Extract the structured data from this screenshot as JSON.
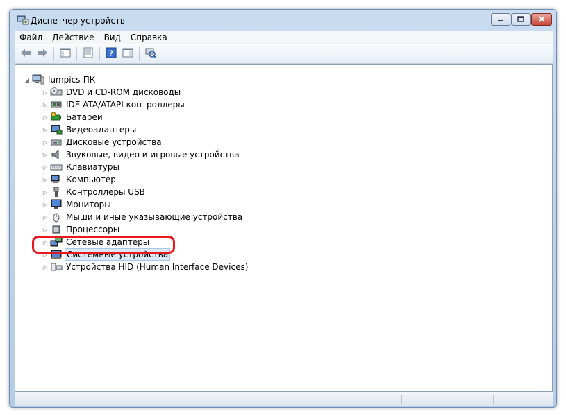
{
  "window": {
    "title": "Диспетчер устройств"
  },
  "menu": [
    "Файл",
    "Действие",
    "Вид",
    "Справка"
  ],
  "toolbar": {
    "buttons": [
      "back-arrow-icon",
      "forward-arrow-icon",
      "show-hide-tree-icon",
      "properties-icon",
      "help-icon",
      "action-pane-icon",
      "scan-hardware-icon"
    ]
  },
  "tree": {
    "root": "lumpics-ПК",
    "items": [
      {
        "label": "DVD и CD-ROM дисководы",
        "icon": "dvd-drive-icon"
      },
      {
        "label": "IDE ATA/ATAPI контроллеры",
        "icon": "ide-controller-icon"
      },
      {
        "label": "Батареи",
        "icon": "battery-icon"
      },
      {
        "label": "Видеоадаптеры",
        "icon": "display-adapter-icon"
      },
      {
        "label": "Дисковые устройства",
        "icon": "disk-drive-icon"
      },
      {
        "label": "Звуковые, видео и игровые устройства",
        "icon": "sound-icon"
      },
      {
        "label": "Клавиатуры",
        "icon": "keyboard-icon"
      },
      {
        "label": "Компьютер",
        "icon": "computer-icon"
      },
      {
        "label": "Контроллеры USB",
        "icon": "usb-icon"
      },
      {
        "label": "Мониторы",
        "icon": "monitor-icon"
      },
      {
        "label": "Мыши и иные указывающие устройства",
        "icon": "mouse-icon"
      },
      {
        "label": "Процессоры",
        "icon": "processor-icon"
      },
      {
        "label": "Сетевые адаптеры",
        "icon": "network-adapter-icon"
      },
      {
        "label": "Системные устройства",
        "icon": "system-device-icon"
      },
      {
        "label": "Устройства HID (Human Interface Devices)",
        "icon": "hid-icon"
      }
    ]
  },
  "colors": {
    "highlight": "#e8191e",
    "selection": "#dbe8f5"
  }
}
